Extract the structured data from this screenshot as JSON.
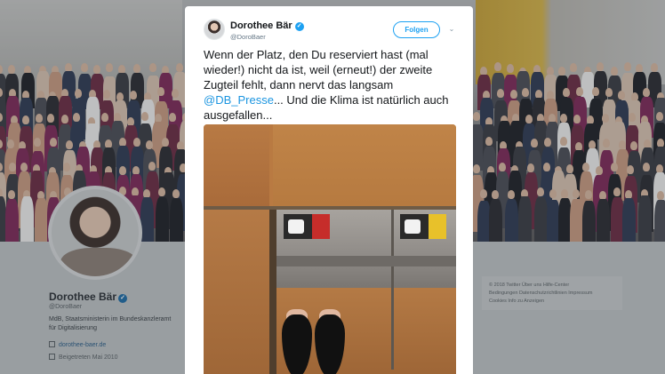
{
  "background_profile": {
    "name": "Dorothee Bär",
    "handle": "@DoroBaer",
    "bio": "MdB, Staatsministerin im Bundeskanzleramt für Digitalisierung",
    "link": "dorothee-baer.de",
    "joined": "Beigetreten Mai 2010",
    "footer_lines": [
      "© 2018 Twitter   Über uns   Hilfe-Center",
      "Bedingungen   Datenschutzrichtlinien   Impressum",
      "Cookies   Info zu Anzeigen"
    ]
  },
  "tweet": {
    "author_name": "Dorothee Bär",
    "author_handle": "@DoroBaer",
    "follow_label": "Folgen",
    "text_before": "Wenn der Platz, den Du reserviert hast (mal wieder!) nicht da ist, weil (erneut!) der zweite Zugteil fehlt, dann nervt das langsam ",
    "mention": "@DB_Presse",
    "text_after": "... Und die Klima ist natürlich auch ausgefallen..."
  },
  "colors": {
    "accent": "#1da1f2",
    "mention": "#1b95e0",
    "verified": "#1da1f2"
  },
  "icons": [
    "verified-badge-icon",
    "chevron-down-icon",
    "link-icon",
    "calendar-icon"
  ]
}
